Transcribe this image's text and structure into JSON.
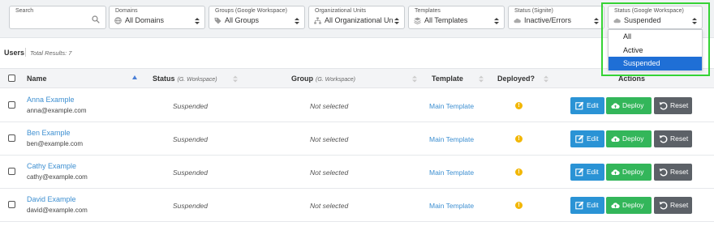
{
  "filters": [
    {
      "label": "Search",
      "value": "",
      "icon": "search-icon"
    },
    {
      "label": "Domains",
      "value": "All Domains",
      "icon": "globe-icon"
    },
    {
      "label": "Groups (Google Workspace)",
      "value": "All Groups",
      "icon": "tag-icon"
    },
    {
      "label": "Organizational Units",
      "value": "All Organizational Un",
      "icon": "sitemap-icon"
    },
    {
      "label": "Templates",
      "value": "All Templates",
      "icon": "layers-icon"
    },
    {
      "label": "Status (Signite)",
      "value": "Inactive/Errors",
      "icon": "cloud-icon"
    },
    {
      "label": "Status (Google Workspace)",
      "value": "Suspended",
      "icon": "cloud-icon"
    }
  ],
  "status_dropdown": {
    "options": [
      "All",
      "Active",
      "Suspended"
    ],
    "selected": "Suspended"
  },
  "users": {
    "label": "Users",
    "total_results": "Total Results: 7"
  },
  "table": {
    "headers": {
      "name": "Name",
      "status": "Status",
      "status_sub": "(G. Workspace)",
      "group": "Group",
      "group_sub": "(G. Workspace)",
      "template": "Template",
      "deployed": "Deployed?",
      "actions": "Actions"
    },
    "rows": [
      {
        "name": "Anna Example",
        "email": "anna@example.com",
        "status": "Suspended",
        "group": "Not selected",
        "template": "Main Template",
        "deployed": "!"
      },
      {
        "name": "Ben Example",
        "email": "ben@example.com",
        "status": "Suspended",
        "group": "Not selected",
        "template": "Main Template",
        "deployed": "!"
      },
      {
        "name": "Cathy Example",
        "email": "cathy@example.com",
        "status": "Suspended",
        "group": "Not selected",
        "template": "Main Template",
        "deployed": "!"
      },
      {
        "name": "David Example",
        "email": "david@example.com",
        "status": "Suspended",
        "group": "Not selected",
        "template": "Main Template",
        "deployed": "!"
      }
    ],
    "buttons": {
      "edit": "Edit",
      "deploy": "Deploy",
      "reset": "Reset"
    }
  },
  "colors": {
    "highlight": "#35d335",
    "selected_option": "#1f6fd6",
    "edit_button": "#2a93d5",
    "deploy_button": "#33b65a",
    "reset_button": "#5c6167",
    "link": "#3d8fd1",
    "warning": "#f2b705"
  }
}
